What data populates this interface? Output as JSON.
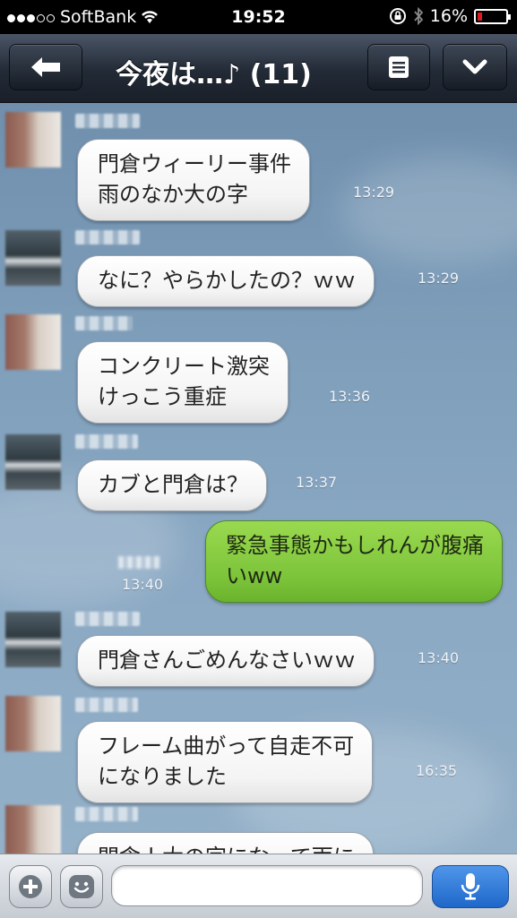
{
  "status_bar": {
    "carrier": "SoftBank",
    "time": "19:52",
    "battery": "16%",
    "battery_level": 0.16,
    "signal_dots_filled": 3,
    "signal_dots_total": 5
  },
  "nav": {
    "title": "今夜は…♪ (11)",
    "back_icon": "back-arrow-icon",
    "menu_icon": "menu-icon",
    "collapse_icon": "chevron-down-icon"
  },
  "messages": [
    {
      "side": "in",
      "text": "門倉ウィーリー事件\n雨のなか大の字",
      "time": "13:29"
    },
    {
      "side": "in",
      "text": "なに？やらかしたの？ｗｗ",
      "time": "13:29"
    },
    {
      "side": "in",
      "text": "コンクリート激突\nけっこう重症",
      "time": "13:36"
    },
    {
      "side": "in",
      "text": "カブと門倉は？",
      "time": "13:37"
    },
    {
      "side": "out",
      "text": "緊急事態かもしれんが腹痛\nいww",
      "time": "13:40"
    },
    {
      "side": "in",
      "text": "門倉さんごめんなさいｗｗ",
      "time": "13:40"
    },
    {
      "side": "in",
      "text": "フレーム曲がって自走不可\nになりました",
      "time": "16:35"
    },
    {
      "side": "in",
      "text": "門倉ｌ大の字になって雨に",
      "time": ""
    }
  ],
  "input_bar": {
    "placeholder": "",
    "add_icon": "plus-icon",
    "sticker_icon": "smiley-icon",
    "voice_icon": "microphone-icon"
  },
  "colors": {
    "nav_bg": "#222a36",
    "chat_bg": "#7f9fbb",
    "incoming_bubble": "#ffffff",
    "outgoing_bubble": "#86cc3f",
    "mic_button": "#2f7bd8",
    "battery_low": "#e01a1a"
  }
}
